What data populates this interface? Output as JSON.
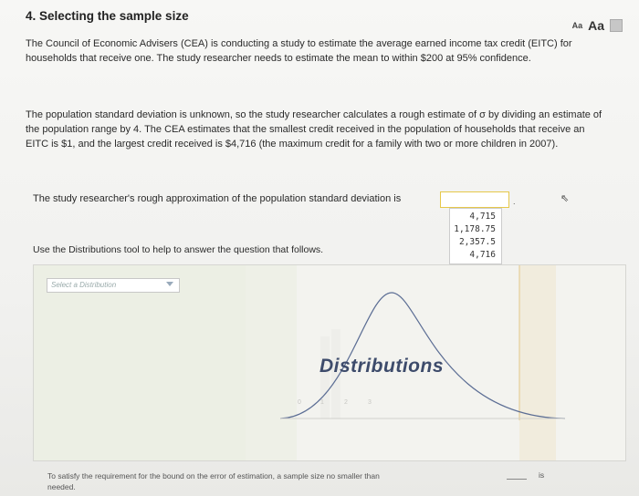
{
  "header": {
    "title": "4. Selecting the sample size",
    "text_size_small": "Aa",
    "text_size_large": "Aa"
  },
  "paragraphs": {
    "p1": "The Council of Economic Advisers (CEA) is conducting a study to estimate the average earned income tax credit (EITC) for households that receive one. The study researcher needs to estimate the mean to within $200 at 95% confidence.",
    "p2": "The population standard deviation is unknown, so the study researcher calculates a rough estimate of σ by dividing an estimate of the population range by 4. The CEA estimates that the smallest credit received in the population of households that receive an EITC is $1, and the largest credit received is $4,716 (the maximum credit for a family with two or more children in 2007)."
  },
  "question": {
    "text": "The study researcher's rough approximation of the population standard deviation is",
    "answer_value": "",
    "trailing": ".",
    "options": [
      "4,715",
      "1,178.75",
      "2,357.5",
      "4,716"
    ]
  },
  "tool": {
    "instruction": "Use the Distributions tool to help to answer the question that follows.",
    "select_placeholder": "Select a Distribution",
    "label": "Distributions",
    "axis_ticks": [
      "0",
      "1",
      "2",
      "3"
    ]
  },
  "footer": {
    "text": "To satisfy the requirement for the bound on the error of estimation, a sample size no smaller than",
    "text_end": "needed.",
    "is": "is"
  }
}
